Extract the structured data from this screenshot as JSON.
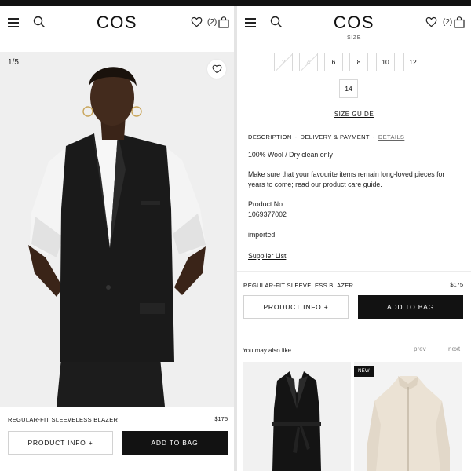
{
  "brand": "COS",
  "header": {
    "bag_count": "(2)"
  },
  "product": {
    "name": "REGULAR-FIT SLEEVELESS BLAZER",
    "price": "$175",
    "slide_counter": "1/5",
    "product_info_label": "PRODUCT INFO +",
    "add_to_bag_label": "ADD TO BAG"
  },
  "sizes": {
    "label": "SIZE",
    "options": [
      {
        "label": "2",
        "available": false
      },
      {
        "label": "4",
        "available": false
      },
      {
        "label": "6",
        "available": true
      },
      {
        "label": "8",
        "available": true
      },
      {
        "label": "10",
        "available": true
      },
      {
        "label": "12",
        "available": true
      },
      {
        "label": "14",
        "available": true
      }
    ],
    "guide_label": "SIZE GUIDE"
  },
  "info_tabs": {
    "description": "DESCRIPTION",
    "delivery": "DELIVERY & PAYMENT",
    "details": "DETAILS",
    "separator": "-"
  },
  "details": {
    "composition": "100% Wool / Dry clean only",
    "care_text": "Make sure that your favourite items remain long-loved pieces for years to come; read our ",
    "care_link": "product care guide",
    "care_end": ".",
    "product_no_label": "Product No:",
    "product_no": "1069377002",
    "origin": "imported",
    "supplier_link": "Supplier List"
  },
  "recommendations": {
    "title": "You may also like...",
    "prev_label": "prev",
    "next_label": "next",
    "badge": "NEW"
  },
  "colors": {
    "button_dark": "#121212",
    "image_bg": "#efefef",
    "text": "#1a1a1a"
  }
}
